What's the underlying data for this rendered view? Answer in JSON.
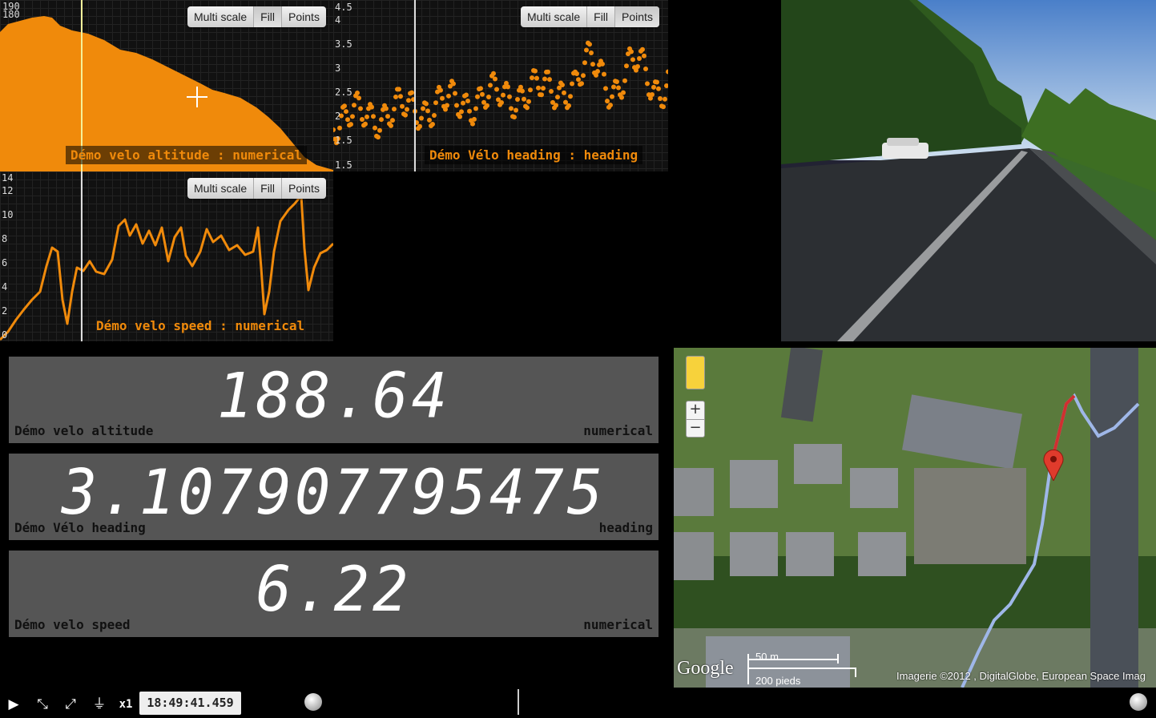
{
  "charts": {
    "buttons": [
      "Multi scale",
      "Fill",
      "Points"
    ],
    "altitude": {
      "label": "Démo velo altitude : numerical",
      "ticks": [
        "190",
        "180"
      ],
      "color": "#f08a0b"
    },
    "heading": {
      "label": "Démo Vélo heading : heading",
      "ticks": [
        "4.5",
        "4",
        "3.5",
        "3",
        "2.5",
        "2",
        "1.5",
        "1.5"
      ],
      "color": "#f08a0b"
    },
    "speed": {
      "label": "Démo velo speed : numerical",
      "ticks": [
        "14",
        "12",
        "10",
        "8",
        "6",
        "4",
        "2",
        "0"
      ],
      "color": "#f08a0b"
    }
  },
  "readouts": [
    {
      "value": "188.64",
      "name": "Démo velo altitude",
      "unit": "numerical"
    },
    {
      "value": "3.107907795475",
      "name": "Démo Vélo heading",
      "unit": "heading"
    },
    {
      "value": "6.22",
      "name": "Démo velo speed",
      "unit": "numerical"
    }
  ],
  "map": {
    "scale_m": "50 m",
    "scale_ft": "200 pieds",
    "logo": "Google",
    "attribution": "Imagerie ©2012 , DigitalGlobe, European Space Imag",
    "zoom_in": "+",
    "zoom_out": "−"
  },
  "transport": {
    "speed": "x1",
    "time": "18:49:41.459"
  },
  "icons": {
    "play": "play-icon",
    "shrink": "shrink-icon",
    "expand": "expand-icon",
    "filter": "filter-icon"
  }
}
